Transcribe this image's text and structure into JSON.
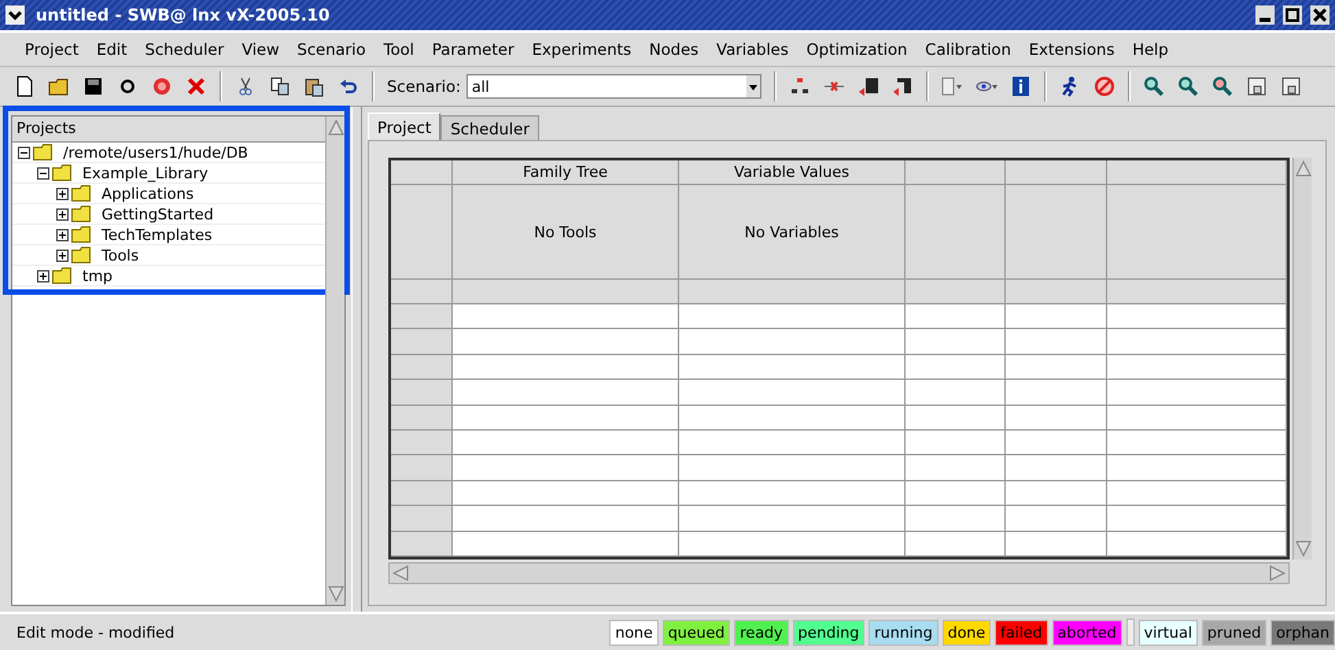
{
  "window": {
    "title": "untitled - SWB@ lnx vX-2005.10"
  },
  "menu": [
    "Project",
    "Edit",
    "Scheduler",
    "View",
    "Scenario",
    "Tool",
    "Parameter",
    "Experiments",
    "Nodes",
    "Variables",
    "Optimization",
    "Calibration",
    "Extensions",
    "Help"
  ],
  "toolbar": {
    "scenario_label": "Scenario:",
    "scenario_value": "all"
  },
  "projects": {
    "heading": "Projects",
    "highlighted": true,
    "tree": [
      {
        "label": "/remote/users1/hude/DB",
        "expanded": true,
        "children": [
          {
            "label": "Example_Library",
            "expanded": true,
            "children": [
              {
                "label": "Applications",
                "expanded": false
              },
              {
                "label": "GettingStarted",
                "expanded": false
              },
              {
                "label": "TechTemplates",
                "expanded": false
              },
              {
                "label": "Tools",
                "expanded": false
              }
            ]
          },
          {
            "label": "tmp",
            "expanded": false
          }
        ]
      }
    ]
  },
  "tabs": [
    {
      "label": "Project",
      "selected": true
    },
    {
      "label": "Scheduler",
      "selected": false
    }
  ],
  "table": {
    "columns": [
      "Family Tree",
      "Variable Values"
    ],
    "placeholders": [
      "No Tools",
      "No Variables"
    ]
  },
  "status_bar": {
    "text": "Edit mode - modified",
    "legend": [
      {
        "label": "none",
        "color": "#ffffff"
      },
      {
        "label": "queued",
        "color": "#80f040"
      },
      {
        "label": "ready",
        "color": "#50f050"
      },
      {
        "label": "pending",
        "color": "#50ff90"
      },
      {
        "label": "running",
        "color": "#a8dcf0"
      },
      {
        "label": "done",
        "color": "#ffd800"
      },
      {
        "label": "failed",
        "color": "#ff0000"
      },
      {
        "label": "aborted",
        "color": "#ff00ff"
      },
      {
        "label": "virtual",
        "color": "#e8ffff"
      },
      {
        "label": "pruned",
        "color": "#a8a8a8"
      },
      {
        "label": "orphan",
        "color": "#787878"
      }
    ]
  }
}
